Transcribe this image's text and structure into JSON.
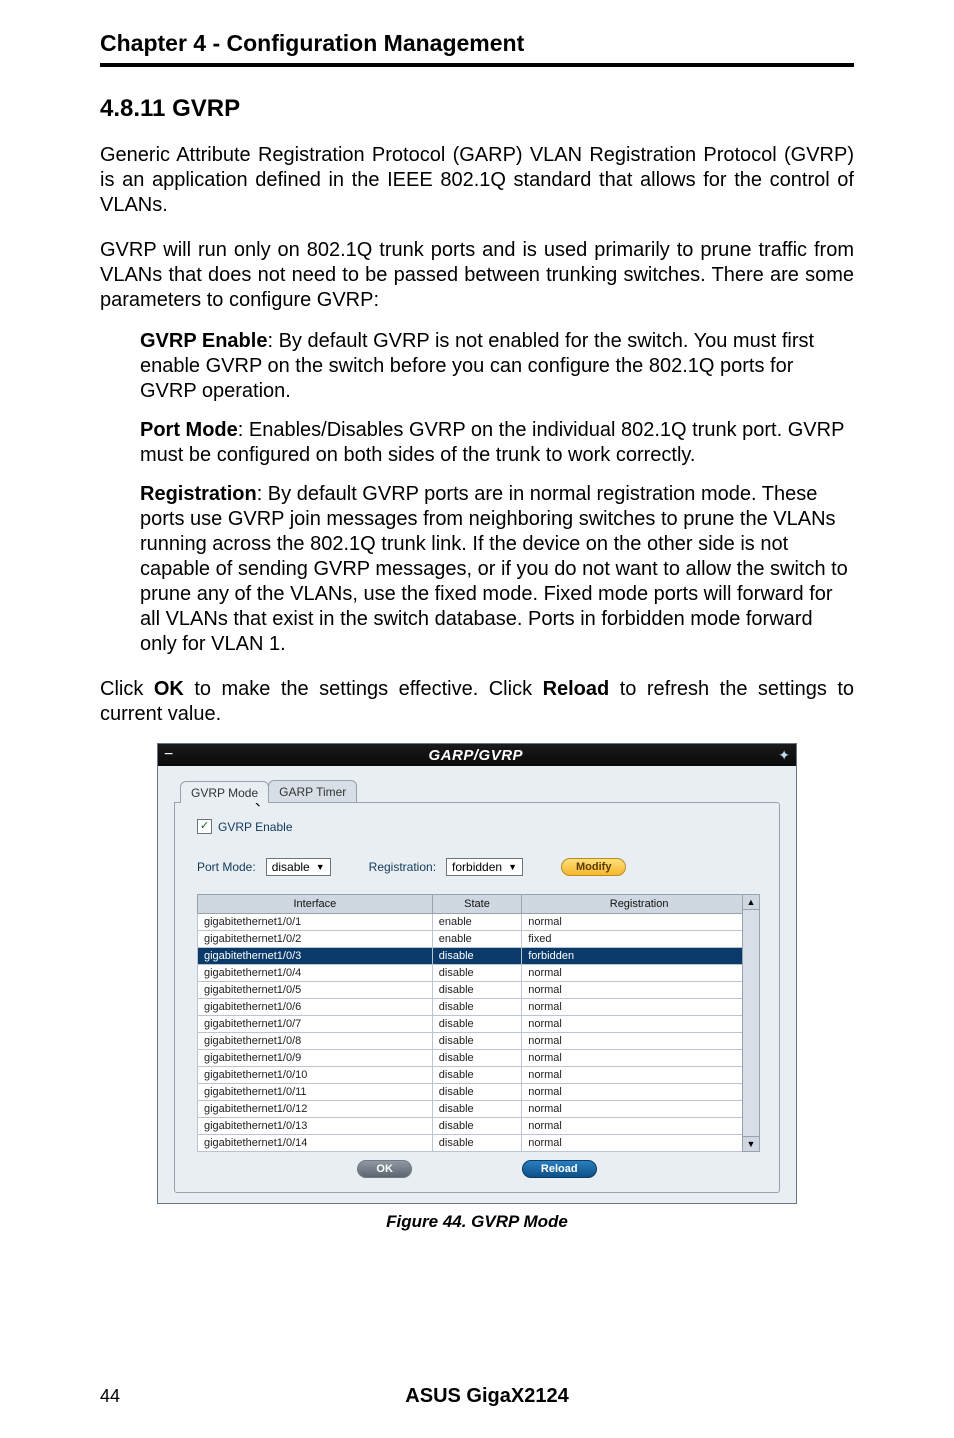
{
  "chapter_header": "Chapter 4 - Configuration Management",
  "section_title": "4.8.11  GVRP",
  "para1": "Generic Attribute Registration Protocol (GARP) VLAN Registration Protocol (GVRP) is an application defined in the IEEE 802.1Q standard that allows for the control of VLANs.",
  "para2": "GVRP will run only on 802.1Q trunk ports and is used primarily to prune traffic from VLANs that does not need to be passed between trunking switches. There are some parameters to configure GVRP:",
  "gvrp_enable_label": "GVRP Enable",
  "gvrp_enable_text": ": By default GVRP is not enabled for the switch. You must first enable GVRP on the switch before you can configure the 802.1Q ports for GVRP operation.",
  "port_mode_label": "Port Mode",
  "port_mode_text": ": Enables/Disables GVRP on the individual 802.1Q trunk port. GVRP must be configured on both sides of the trunk to work correctly.",
  "registration_label": "Registration",
  "registration_text": ": By default GVRP ports are in normal registration mode. These ports use GVRP join messages from neighboring switches to prune the VLANs running across the 802.1Q trunk link. If the device on the other side is not capable of sending GVRP messages, or if you do not want to allow the switch to prune any of the VLANs, use the fixed mode. Fixed mode ports will forward for all VLANs that exist in the switch database. Ports in forbidden mode forward only for VLAN 1.",
  "click_text_pre": "Click ",
  "ok_word": "OK",
  "click_text_mid": " to make the settings effective. Click ",
  "reload_word": "Reload",
  "click_text_post": " to refresh the settings to current value.",
  "figure_caption": "Figure 44. GVRP Mode",
  "footer_page": "44",
  "footer_title": "ASUS GigaX2124",
  "screenshot": {
    "titlebar": "GARP/GVRP",
    "tabs": {
      "active": "GVRP Mode",
      "other": "GARP Timer"
    },
    "gvrp_enable_checkbox_label": "GVRP Enable",
    "gvrp_enable_checked": "✓",
    "port_mode_label": "Port Mode:",
    "port_mode_value": "disable",
    "registration_label": "Registration:",
    "registration_value": "forbidden",
    "modify_btn": "Modify",
    "ok_btn": "OK",
    "reload_btn": "Reload",
    "headers": {
      "iface": "Interface",
      "state": "State",
      "reg": "Registration"
    },
    "rows": [
      {
        "iface": "gigabitethernet1/0/1",
        "state": "enable",
        "reg": "normal",
        "sel": false
      },
      {
        "iface": "gigabitethernet1/0/2",
        "state": "enable",
        "reg": "fixed",
        "sel": false
      },
      {
        "iface": "gigabitethernet1/0/3",
        "state": "disable",
        "reg": "forbidden",
        "sel": true
      },
      {
        "iface": "gigabitethernet1/0/4",
        "state": "disable",
        "reg": "normal",
        "sel": false
      },
      {
        "iface": "gigabitethernet1/0/5",
        "state": "disable",
        "reg": "normal",
        "sel": false
      },
      {
        "iface": "gigabitethernet1/0/6",
        "state": "disable",
        "reg": "normal",
        "sel": false
      },
      {
        "iface": "gigabitethernet1/0/7",
        "state": "disable",
        "reg": "normal",
        "sel": false
      },
      {
        "iface": "gigabitethernet1/0/8",
        "state": "disable",
        "reg": "normal",
        "sel": false
      },
      {
        "iface": "gigabitethernet1/0/9",
        "state": "disable",
        "reg": "normal",
        "sel": false
      },
      {
        "iface": "gigabitethernet1/0/10",
        "state": "disable",
        "reg": "normal",
        "sel": false
      },
      {
        "iface": "gigabitethernet1/0/11",
        "state": "disable",
        "reg": "normal",
        "sel": false
      },
      {
        "iface": "gigabitethernet1/0/12",
        "state": "disable",
        "reg": "normal",
        "sel": false
      },
      {
        "iface": "gigabitethernet1/0/13",
        "state": "disable",
        "reg": "normal",
        "sel": false
      },
      {
        "iface": "gigabitethernet1/0/14",
        "state": "disable",
        "reg": "normal",
        "sel": false
      }
    ]
  }
}
